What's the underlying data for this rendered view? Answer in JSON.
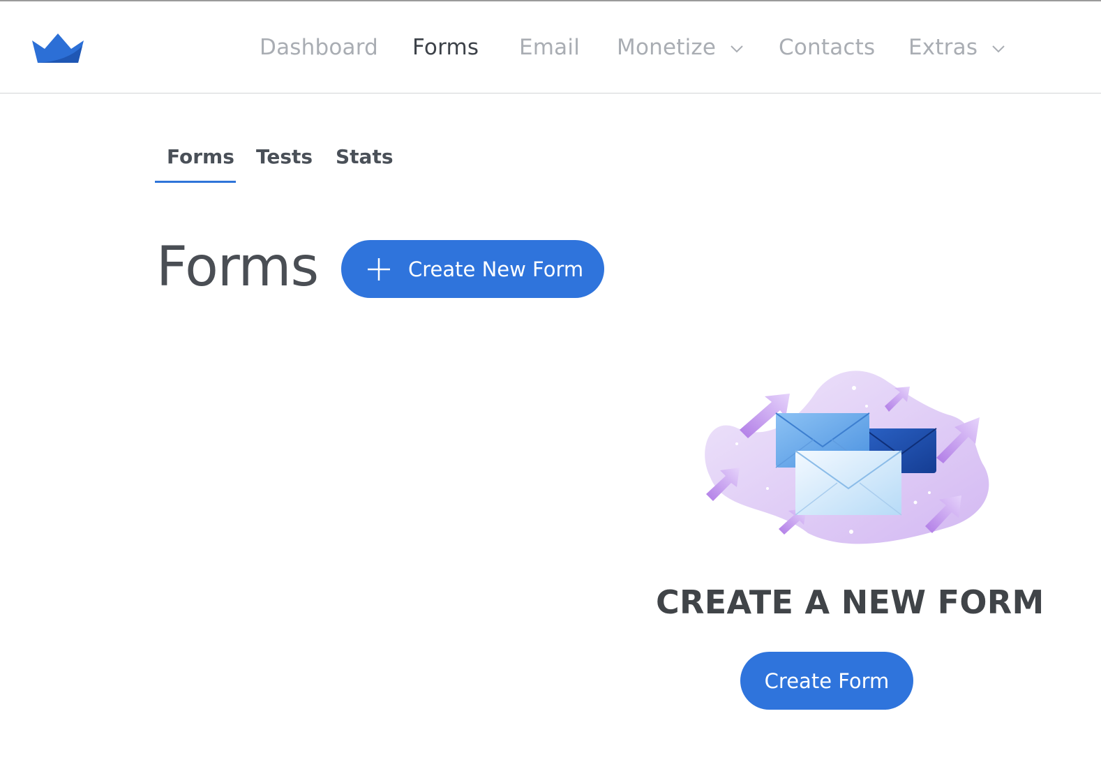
{
  "nav": {
    "items": [
      {
        "label": "Dashboard",
        "active": false,
        "dropdown": false
      },
      {
        "label": "Forms",
        "active": true,
        "dropdown": false
      },
      {
        "label": "Email",
        "active": false,
        "dropdown": false
      },
      {
        "label": "Monetize",
        "active": false,
        "dropdown": true
      },
      {
        "label": "Contacts",
        "active": false,
        "dropdown": false
      },
      {
        "label": "Extras",
        "active": false,
        "dropdown": true
      }
    ]
  },
  "subtabs": {
    "items": [
      {
        "label": "Forms",
        "active": true
      },
      {
        "label": "Tests",
        "active": false
      },
      {
        "label": "Stats",
        "active": false
      }
    ]
  },
  "page": {
    "title": "Forms",
    "create_new_label": "Create New Form"
  },
  "empty_state": {
    "heading": "CREATE A NEW FORM",
    "button_label": "Create Form"
  },
  "colors": {
    "accent": "#2f74dc",
    "nav_inactive": "#a9adb3",
    "nav_active": "#3c4148"
  },
  "icons": {
    "logo": "crown-logo-icon",
    "dropdown": "chevron-down-icon",
    "add": "plus-icon",
    "illustration": "envelopes-illustration"
  }
}
